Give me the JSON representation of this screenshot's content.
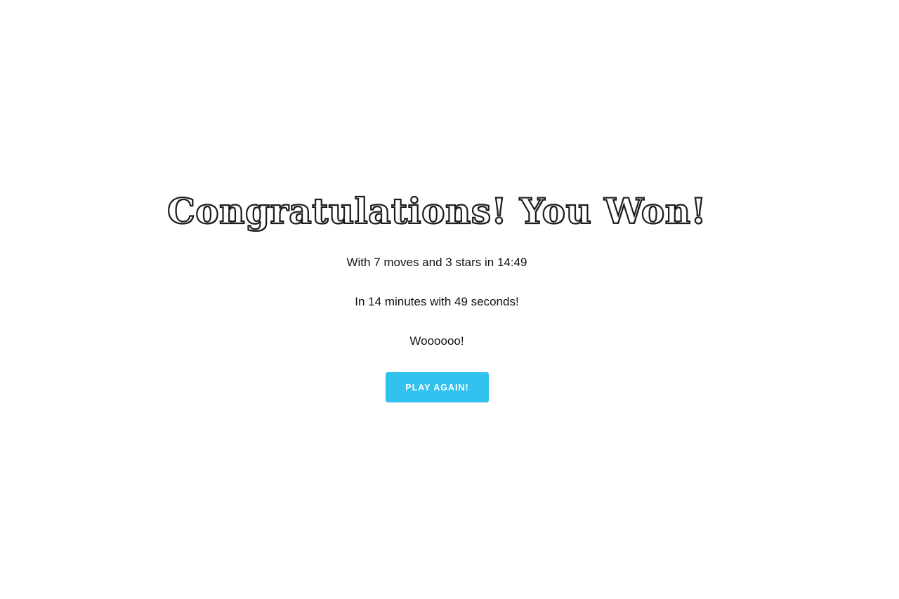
{
  "win_modal": {
    "title": "Congratulations! You Won!",
    "summary": "With 7 moves and 3 stars in 14:49",
    "time_detail": "In 14 minutes with 49 seconds!",
    "cheer": "Woooooo!",
    "play_again_label": "PLAY AGAIN!"
  },
  "colors": {
    "background": "#ffffff",
    "title_outline": "#1c1c1c",
    "text": "#111111",
    "button_background": "#31c2ef",
    "button_text": "#ffffff"
  }
}
